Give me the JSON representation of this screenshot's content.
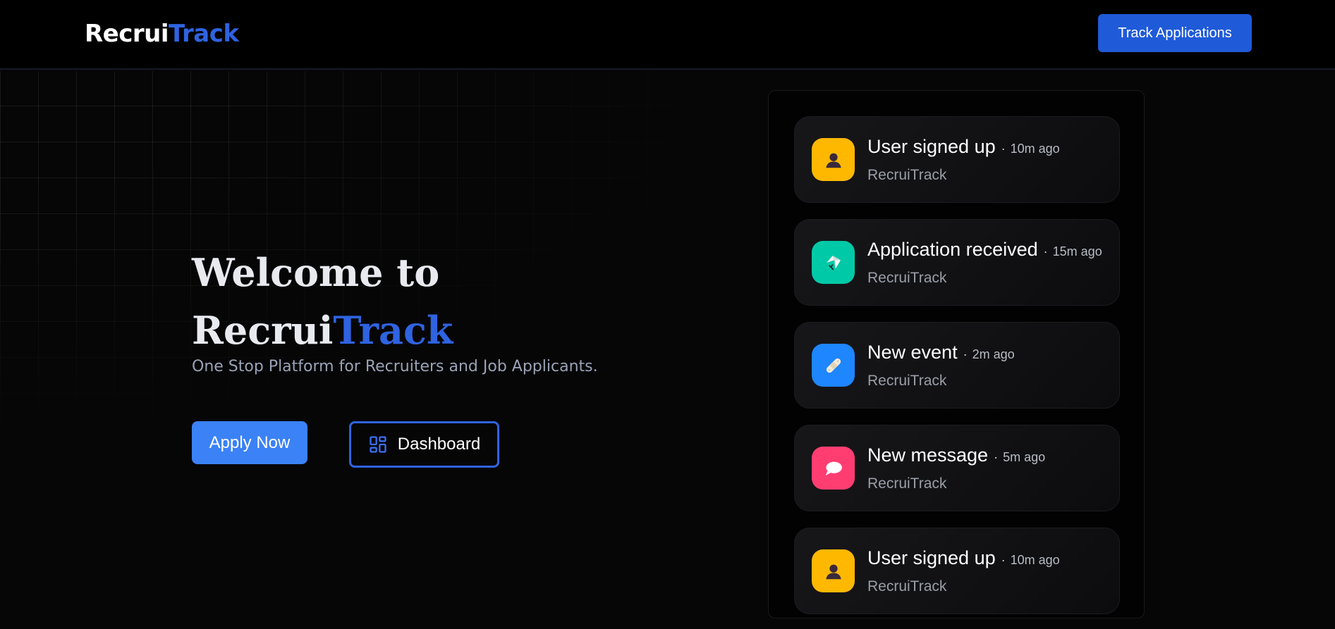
{
  "header": {
    "logo_part1": "Recrui",
    "logo_part2": "Track",
    "track_button": "Track Applications"
  },
  "hero": {
    "title_line1": "Welcome to",
    "title_part1": "Recrui",
    "title_part2": "Track",
    "subtitle": "One Stop Platform for Recruiters and Job Applicants.",
    "apply_button": "Apply Now",
    "dashboard_button": "Dashboard"
  },
  "feed": {
    "items": [
      {
        "title": "User signed up",
        "separator": "·",
        "time": "10m ago",
        "source": "RecruiTrack",
        "icon": "user-icon",
        "color": "#FFB800"
      },
      {
        "title": "Application received",
        "separator": "·",
        "time": "15m ago",
        "source": "RecruiTrack",
        "icon": "application-icon",
        "color": "#00C9A7"
      },
      {
        "title": "New event",
        "separator": "·",
        "time": "2m ago",
        "source": "RecruiTrack",
        "icon": "event-icon",
        "color": "#1E86FF"
      },
      {
        "title": "New message",
        "separator": "·",
        "time": "5m ago",
        "source": "RecruiTrack",
        "icon": "message-icon",
        "color": "#FF3D71"
      },
      {
        "title": "User signed up",
        "separator": "·",
        "time": "10m ago",
        "source": "RecruiTrack",
        "icon": "user-icon",
        "color": "#FFB800"
      }
    ]
  },
  "colors": {
    "accent": "#2F63E0",
    "apply_button": "#3B82F6",
    "background": "#060607"
  }
}
